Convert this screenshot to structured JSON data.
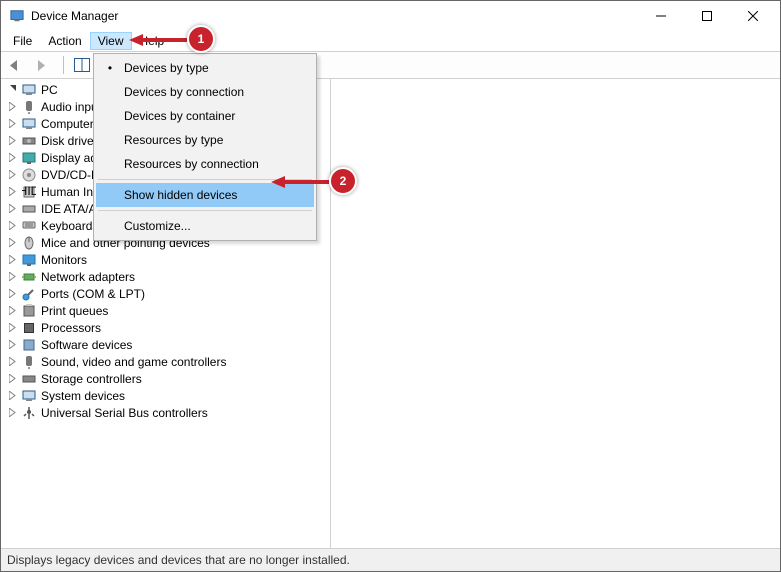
{
  "window": {
    "title": "Device Manager"
  },
  "menubar": {
    "items": [
      "File",
      "Action",
      "View",
      "Help"
    ],
    "activeIndex": 2
  },
  "dropdown": {
    "items": [
      {
        "label": "Devices by type",
        "selected": true
      },
      {
        "label": "Devices by connection"
      },
      {
        "label": "Devices by container"
      },
      {
        "label": "Resources by type"
      },
      {
        "label": "Resources by connection"
      },
      {
        "sep": true
      },
      {
        "label": "Show hidden devices",
        "highlighted": true
      },
      {
        "sep": true
      },
      {
        "label": "Customize..."
      }
    ]
  },
  "tree": {
    "root": "PC",
    "categories": [
      "Audio inputs and outputs",
      "Computer",
      "Disk drives",
      "Display adapters",
      "DVD/CD-ROM drives",
      "Human Interface Devices",
      "IDE ATA/ATAPI controllers",
      "Keyboards",
      "Mice and other pointing devices",
      "Monitors",
      "Network adapters",
      "Ports (COM & LPT)",
      "Print queues",
      "Processors",
      "Software devices",
      "Sound, video and game controllers",
      "Storage controllers",
      "System devices",
      "Universal Serial Bus controllers"
    ]
  },
  "statusbar": {
    "text": "Displays legacy devices and devices that are no longer installed."
  },
  "callouts": {
    "one": "1",
    "two": "2"
  }
}
